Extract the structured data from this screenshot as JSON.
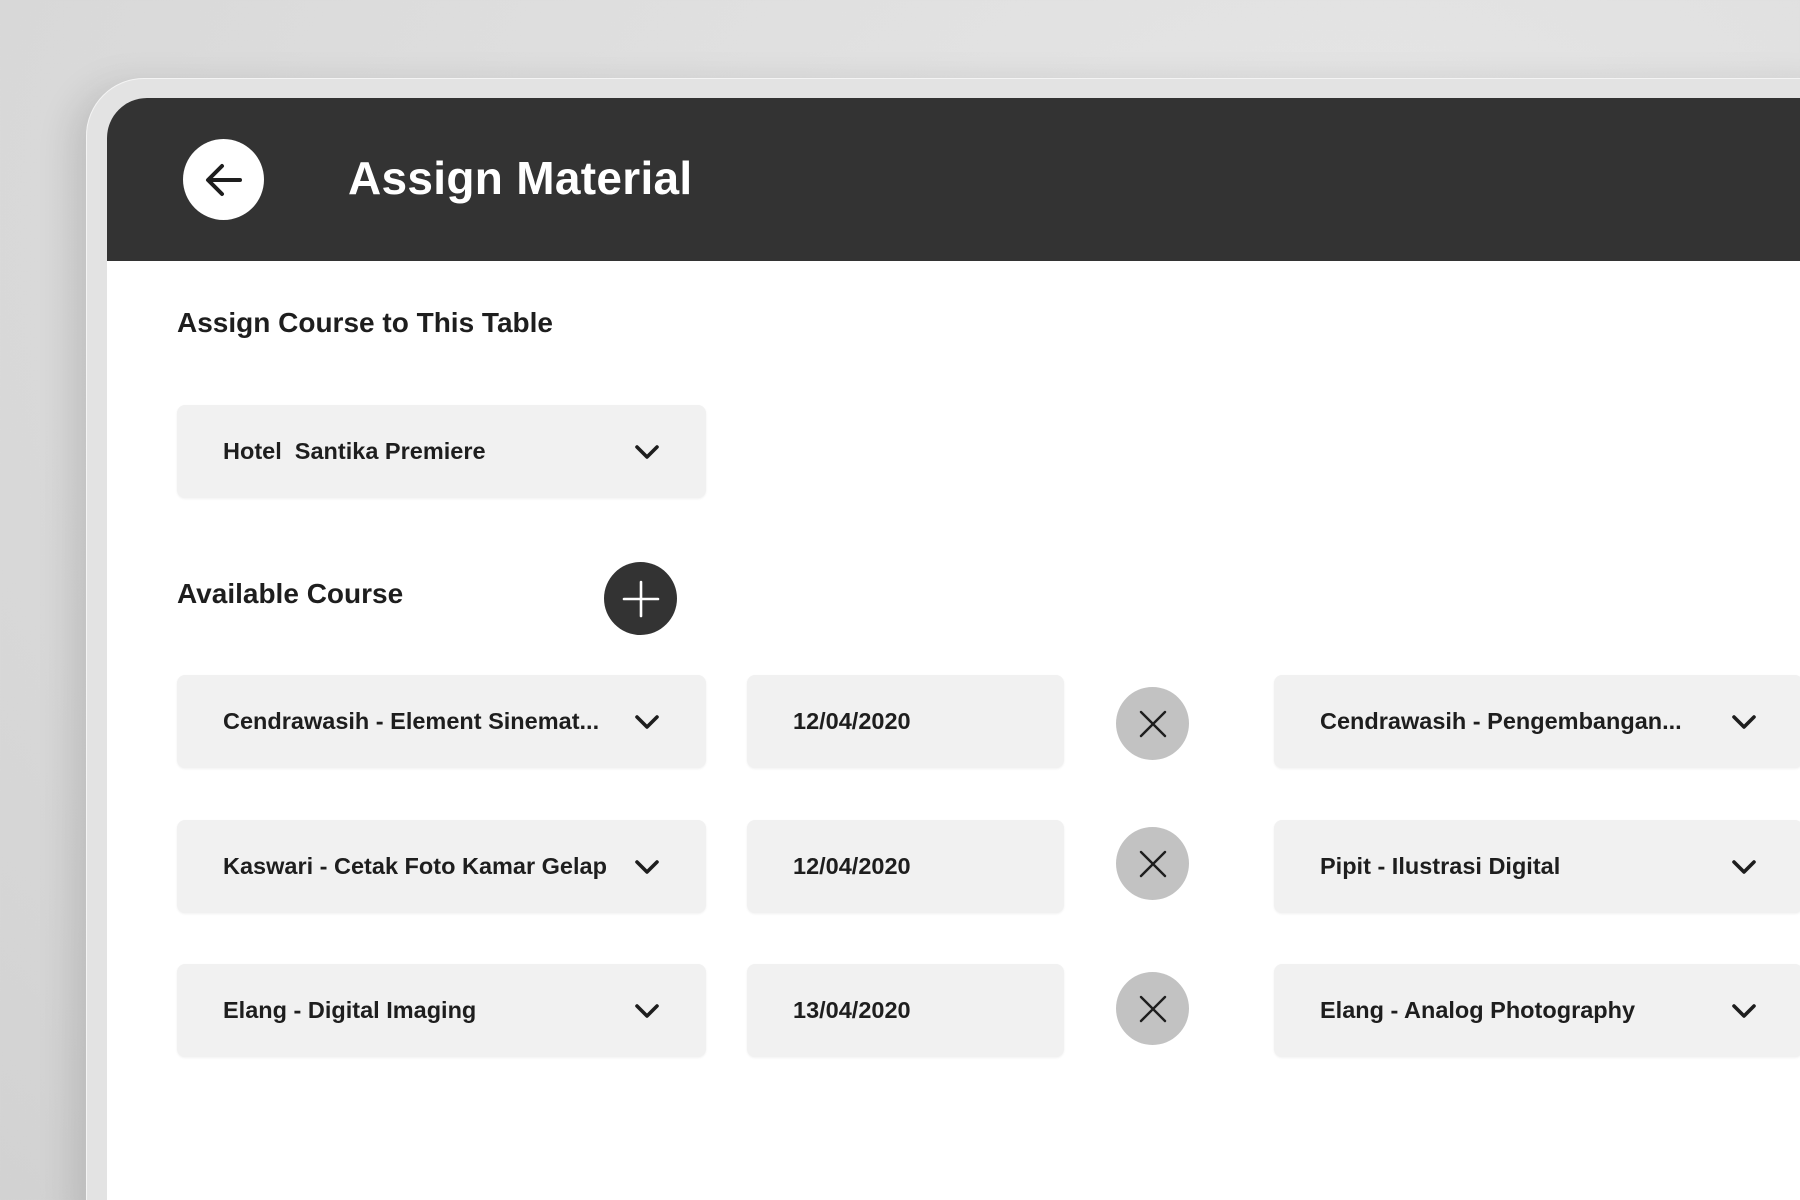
{
  "header": {
    "title": "Assign Material",
    "back_icon": "arrow-left-icon"
  },
  "assign_section": {
    "title": "Assign Course to This Table",
    "table_select": {
      "value": "Hotel  Santika Premiere",
      "icon": "chevron-down-icon"
    }
  },
  "available_section": {
    "title": "Available Course",
    "add_icon": "plus-icon",
    "rows": [
      {
        "course": "Cendrawasih - Element  Sinemat...",
        "date": "12/04/2020",
        "remove_icon": "close-icon",
        "second_course": "Cendrawasih - Pengembangan..."
      },
      {
        "course": "Kaswari - Cetak Foto Kamar Gelap",
        "date": "12/04/2020",
        "remove_icon": "close-icon",
        "second_course": "Pipit - Ilustrasi Digital"
      },
      {
        "course": "Elang - Digital Imaging",
        "date": "13/04/2020",
        "remove_icon": "close-icon",
        "second_course": "Elang - Analog Photography"
      }
    ]
  },
  "colors": {
    "header_bg": "#333333",
    "field_bg": "#f1f1f1",
    "remove_button_bg": "#c2c2c2",
    "add_button_bg": "#333333",
    "text": "#1e1e1e"
  }
}
